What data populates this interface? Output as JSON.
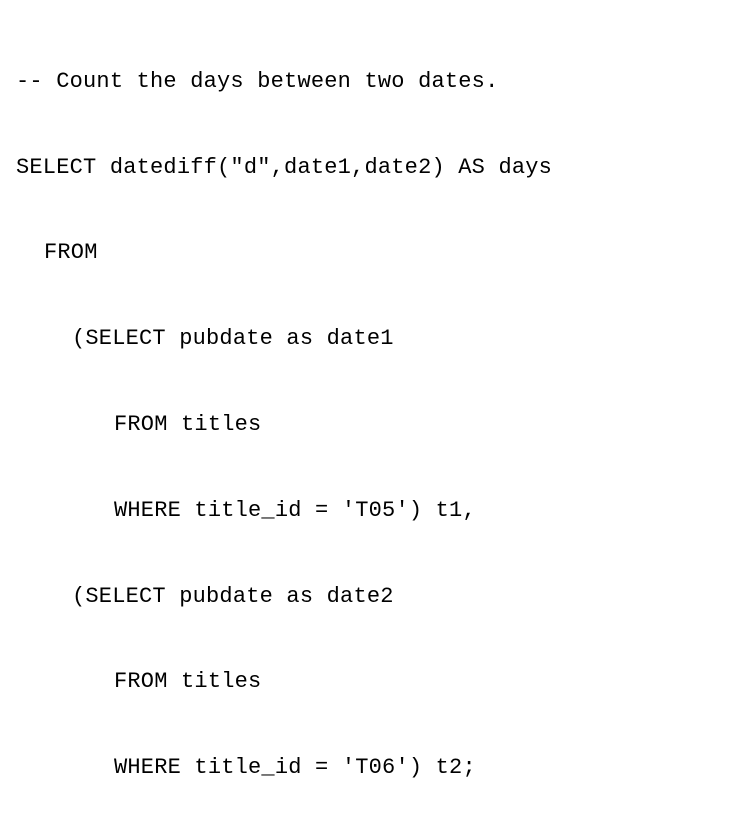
{
  "code": {
    "line1": "-- Count the days between two dates.",
    "line2": "SELECT datediff(\"d\",date1,date2) AS days",
    "line3": "FROM",
    "line4": "(SELECT pubdate as date1",
    "line5": "FROM titles",
    "line6": "WHERE title_id = 'T05') t1,",
    "line7": "(SELECT pubdate as date2",
    "line8": "FROM titles",
    "line9": "WHERE title_id = 'T06') t2;"
  }
}
